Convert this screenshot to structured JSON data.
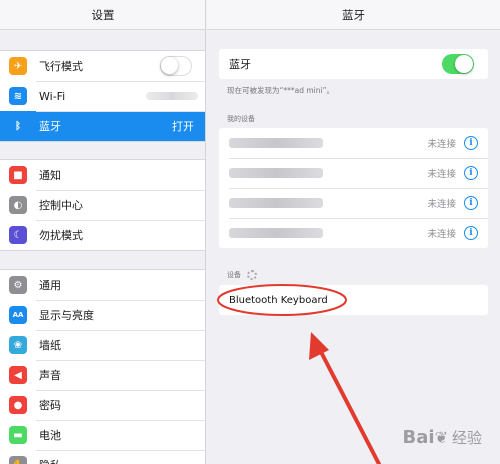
{
  "left_pane": {
    "title": "设置",
    "groups": [
      [
        {
          "label": "飞行模式",
          "icon": "airplane-icon",
          "color": "#f7a11a",
          "glyph": "✈",
          "accessory": "switch-off"
        },
        {
          "label": "Wi-Fi",
          "icon": "wifi-icon",
          "color": "#1a8cf0",
          "glyph": "≋",
          "accessory": "blurred-value"
        },
        {
          "label": "蓝牙",
          "icon": "bluetooth-icon",
          "color": "#1a8cf0",
          "glyph": "ᛒ",
          "accessory": "value",
          "value": "打开",
          "selected": true
        }
      ],
      [
        {
          "label": "通知",
          "icon": "notifications-icon",
          "color": "#f0413a",
          "glyph": "■"
        },
        {
          "label": "控制中心",
          "icon": "control-center-icon",
          "color": "#8e8e93",
          "glyph": "◐"
        },
        {
          "label": "勿扰模式",
          "icon": "moon-icon",
          "color": "#5b4fd6",
          "glyph": "☾"
        }
      ],
      [
        {
          "label": "通用",
          "icon": "gear-icon",
          "color": "#8e8e93",
          "glyph": "⚙"
        },
        {
          "label": "显示与亮度",
          "icon": "display-brightness-icon",
          "color": "#1a8cf0",
          "glyph": "AA"
        },
        {
          "label": "墙纸",
          "icon": "wallpaper-icon",
          "color": "#34aadc",
          "glyph": "❀"
        },
        {
          "label": "声音",
          "icon": "sound-icon",
          "color": "#f0413a",
          "glyph": "◀"
        },
        {
          "label": "密码",
          "icon": "passcode-icon",
          "color": "#f0413a",
          "glyph": "●"
        },
        {
          "label": "电池",
          "icon": "battery-icon",
          "color": "#4cd964",
          "glyph": "▬"
        },
        {
          "label": "隐私",
          "icon": "privacy-icon",
          "color": "#8e8e93",
          "glyph": "✋"
        }
      ]
    ]
  },
  "right_pane": {
    "title": "蓝牙",
    "bluetooth_toggle_label": "蓝牙",
    "discoverable_note": "现在可被发现为“***ad mini”。",
    "my_devices_header": "我的设备",
    "my_devices": [
      {
        "status": "未连接",
        "blur_width": 94
      },
      {
        "status": "未连接",
        "blur_width": 94
      },
      {
        "status": "未连接",
        "blur_width": 94
      },
      {
        "status": "未连接",
        "blur_width": 94
      }
    ],
    "devices_header": "设备",
    "found_device": "Bluetooth Keyboard",
    "info_glyph": "i"
  },
  "watermark": {
    "brand": "Bai",
    "brand_end": "百",
    "suffix": "经验"
  }
}
